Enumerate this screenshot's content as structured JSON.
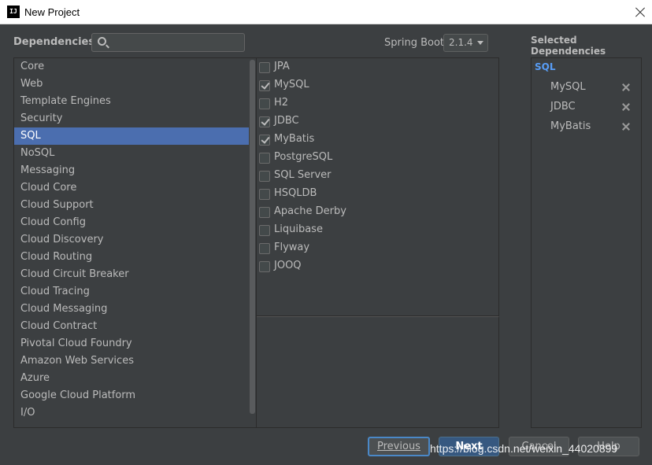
{
  "window": {
    "title": "New Project",
    "icon": "intellij-icon"
  },
  "dependencies_label": "Dependencies",
  "search": {
    "value": "",
    "placeholder": ""
  },
  "spring_boot": {
    "label": "Spring Boot",
    "value": "2.1.4"
  },
  "categories": {
    "items": [
      "Core",
      "Web",
      "Template Engines",
      "Security",
      "SQL",
      "NoSQL",
      "Messaging",
      "Cloud Core",
      "Cloud Support",
      "Cloud Config",
      "Cloud Discovery",
      "Cloud Routing",
      "Cloud Circuit Breaker",
      "Cloud Tracing",
      "Cloud Messaging",
      "Cloud Contract",
      "Pivotal Cloud Foundry",
      "Amazon Web Services",
      "Azure",
      "Google Cloud Platform",
      "I/O"
    ],
    "selected": "SQL"
  },
  "deps": [
    {
      "name": "JPA",
      "checked": false
    },
    {
      "name": "MySQL",
      "checked": true
    },
    {
      "name": "H2",
      "checked": false
    },
    {
      "name": "JDBC",
      "checked": true
    },
    {
      "name": "MyBatis",
      "checked": true
    },
    {
      "name": "PostgreSQL",
      "checked": false
    },
    {
      "name": "SQL Server",
      "checked": false
    },
    {
      "name": "HSQLDB",
      "checked": false
    },
    {
      "name": "Apache Derby",
      "checked": false
    },
    {
      "name": "Liquibase",
      "checked": false
    },
    {
      "name": "Flyway",
      "checked": false
    },
    {
      "name": "JOOQ",
      "checked": false
    }
  ],
  "selected_dependencies": {
    "title": "Selected Dependencies",
    "group": "SQL",
    "items": [
      "MySQL",
      "JDBC",
      "MyBatis"
    ]
  },
  "buttons": {
    "previous": "Previous",
    "next": "Next",
    "cancel": "Cancel",
    "help": "Help"
  },
  "watermark": "https://blog.csdn.net/weixin_44020899",
  "colors": {
    "selection": "#4b6eaf",
    "accent": "#589df6",
    "background": "#3c3f41"
  }
}
